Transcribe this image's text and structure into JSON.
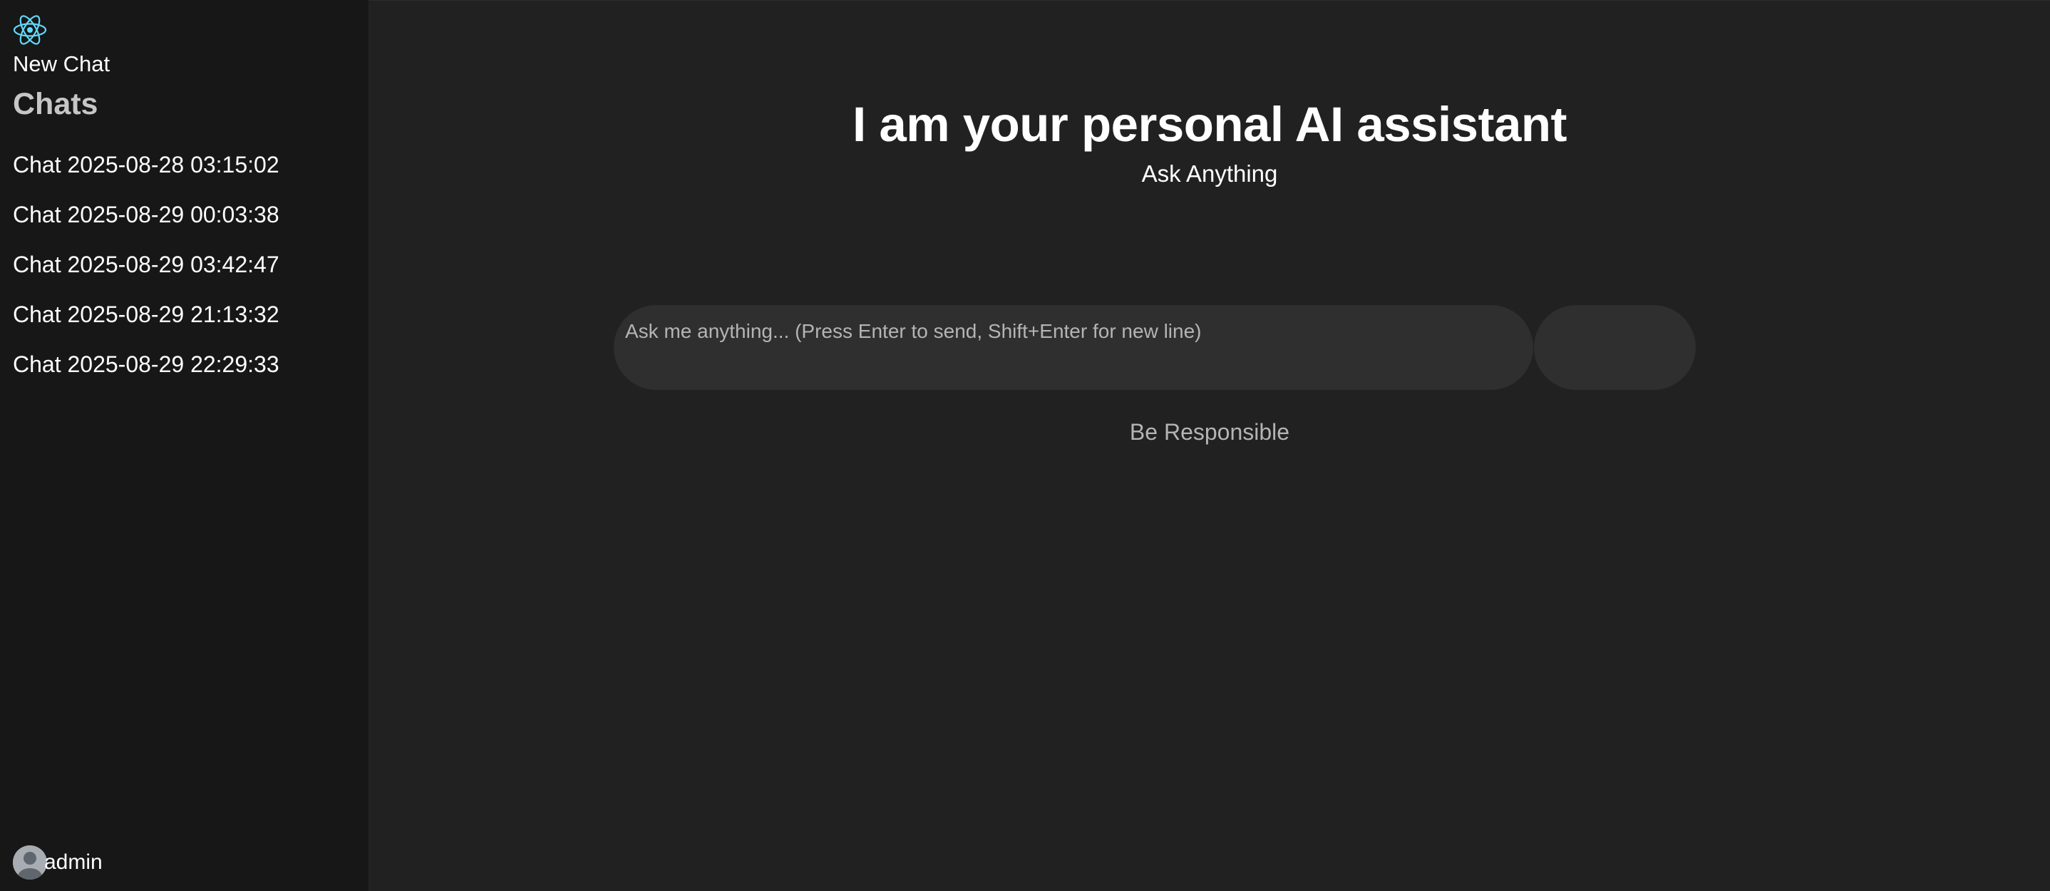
{
  "sidebar": {
    "logo_icon": "react-atom-icon",
    "new_chat_label": "New Chat",
    "chats_heading": "Chats",
    "chats": [
      {
        "label": "Chat 2025-08-28 03:15:02"
      },
      {
        "label": "Chat 2025-08-29 00:03:38"
      },
      {
        "label": "Chat 2025-08-29 03:42:47"
      },
      {
        "label": "Chat 2025-08-29 21:13:32"
      },
      {
        "label": "Chat 2025-08-29 22:29:33"
      }
    ],
    "user": {
      "avatar_icon": "user-avatar-icon",
      "name": "admin"
    }
  },
  "main": {
    "title": "I am your personal AI assistant",
    "subtitle": "Ask Anything",
    "input": {
      "value": "",
      "placeholder": "Ask me anything... (Press Enter to send, Shift+Enter for new line)"
    },
    "send_button_label": "",
    "footer_note": "Be Responsible"
  },
  "colors": {
    "sidebar_bg": "#171717",
    "main_bg": "#212121",
    "input_bg": "#2f2f2f",
    "logo_accent": "#61dafb",
    "muted_text": "#b4b4b4"
  }
}
